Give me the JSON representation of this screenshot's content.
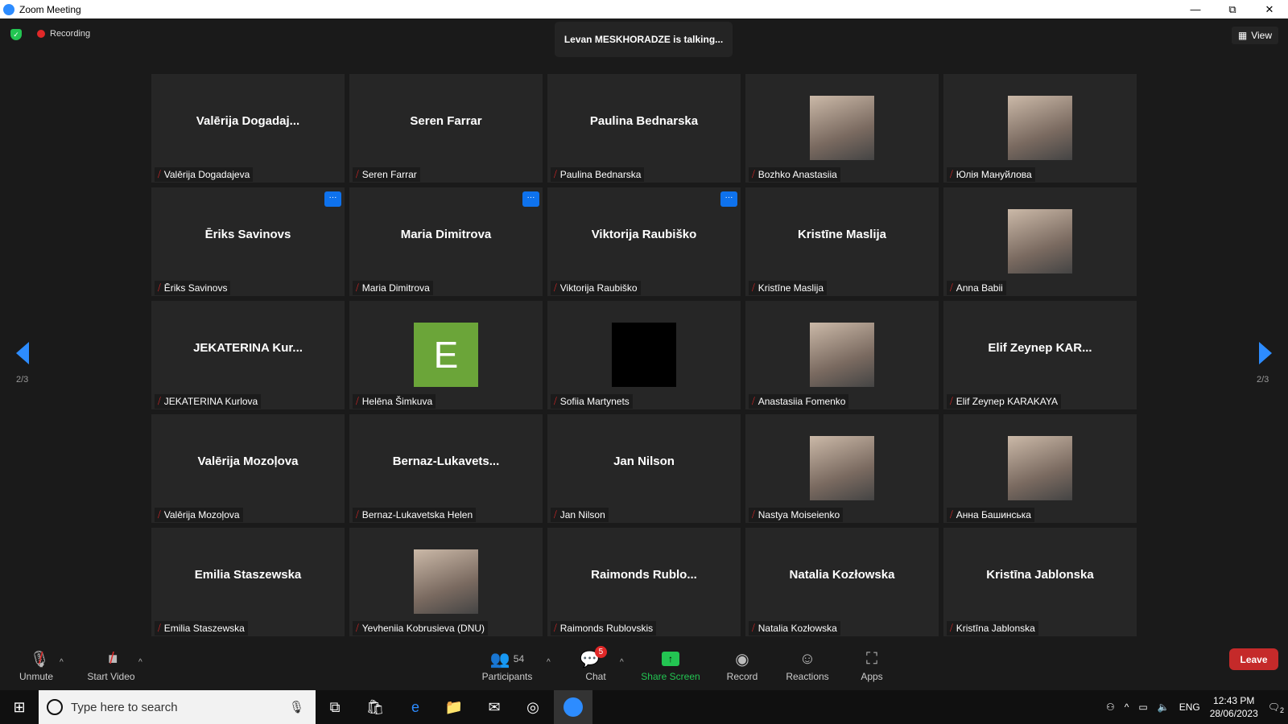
{
  "window": {
    "title": "Zoom Meeting"
  },
  "top": {
    "recording": "Recording",
    "talking": "Levan MESKHORADZE is talking...",
    "view": "View"
  },
  "page_indicator": {
    "left": "2/3",
    "right": "2/3"
  },
  "tiles": [
    {
      "big": "Valērija  Dogadaj...",
      "label": "Valērija Dogadajeva"
    },
    {
      "big": "Seren Farrar",
      "label": "Seren Farrar"
    },
    {
      "big": "Paulina Bednarska",
      "label": "Paulina Bednarska"
    },
    {
      "avatar": "photo",
      "label": "Bozhko Anastasiia"
    },
    {
      "avatar": "photo",
      "label": "Юлія Мануйлова"
    },
    {
      "big": "Ēriks Savinovs",
      "label": "Ēriks Savinovs",
      "more": true
    },
    {
      "big": "Maria Dimitrova",
      "label": "Maria Dimitrova",
      "more": true
    },
    {
      "big": "Viktorija Raubiško",
      "label": "Viktorija Raubiško",
      "more": true
    },
    {
      "big": "Kristīne Maslija",
      "label": "Kristīne Maslija"
    },
    {
      "avatar": "photo",
      "label": "Anna Babii"
    },
    {
      "big": "JEKATERINA  Kur...",
      "label": "JEKATERINA Kurlova"
    },
    {
      "avatar": "letter",
      "letter": "E",
      "label": "Helēna Šimkuva"
    },
    {
      "avatar": "black",
      "label": "Sofiia Martynets"
    },
    {
      "avatar": "photo",
      "label": "Anastasiia Fomenko"
    },
    {
      "big": "Elif Zeynep  KAR...",
      "label": "Elif Zeynep KARAKAYA"
    },
    {
      "big": "Valērija Mozoļova",
      "label": "Valērija Mozoļova"
    },
    {
      "big": "Bernaz-Lukavets...",
      "label": "Bernaz-Lukavetska Helen"
    },
    {
      "big": "Jan Nilson",
      "label": "Jan Nilson"
    },
    {
      "avatar": "photo",
      "label": "Nastya Moiseienko"
    },
    {
      "avatar": "photo",
      "label": "Анна Башинська"
    },
    {
      "big": "Emilia Staszewska",
      "label": "Emilia Staszewska"
    },
    {
      "avatar": "photo",
      "label": "Yevheniia Kobrusieva (DNU)"
    },
    {
      "big": "Raimonds  Rublo...",
      "label": "Raimonds Rublovskis"
    },
    {
      "big": "Natalia Kozłowska",
      "label": "Natalia Kozłowska"
    },
    {
      "big": "Kristīna Jablonska",
      "label": "Kristīna Jablonska"
    }
  ],
  "toolbar": {
    "unmute": "Unmute",
    "start_video": "Start Video",
    "participants": "Participants",
    "participants_count": "54",
    "chat": "Chat",
    "chat_badge": "5",
    "share": "Share Screen",
    "record": "Record",
    "reactions": "Reactions",
    "apps": "Apps",
    "leave": "Leave"
  },
  "taskbar": {
    "search_placeholder": "Type here to search",
    "lang": "ENG",
    "time": "12:43 PM",
    "date": "28/06/2023",
    "notif": "2"
  },
  "colors": {
    "accent": "#0e72ed",
    "share": "#23c552",
    "leave": "#c52a2a",
    "mute": "#e02828"
  }
}
